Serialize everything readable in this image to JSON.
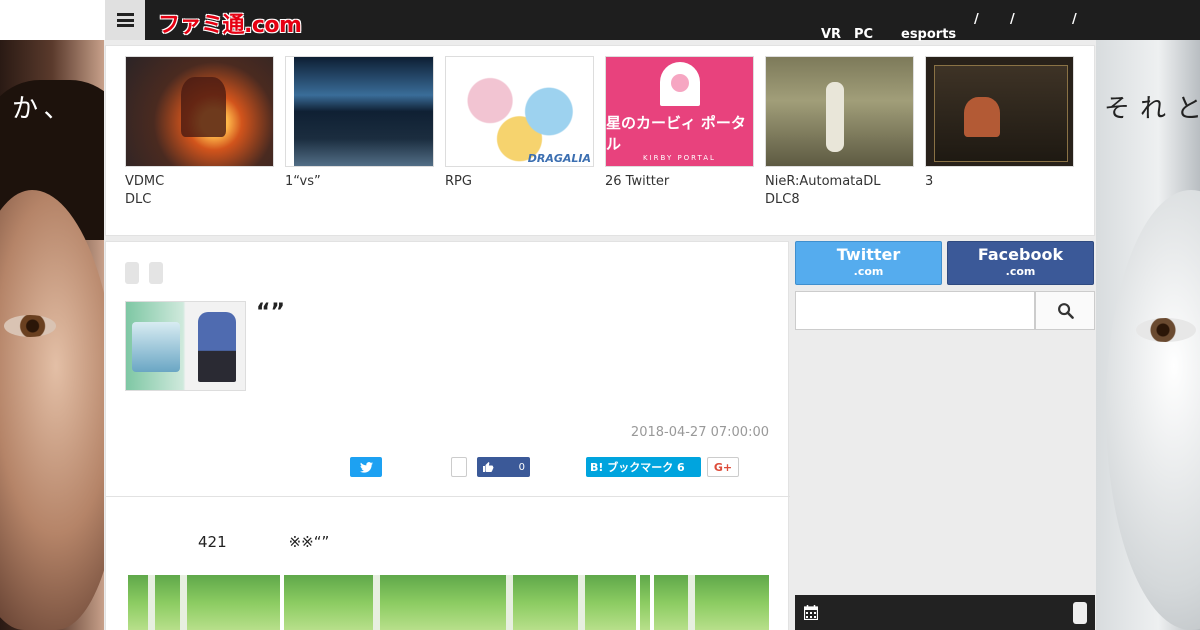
{
  "background": {
    "left_text": "か、",
    "right_text": "それと"
  },
  "header": {
    "logo": "ファミ通.com",
    "nav": [
      "VR",
      "PC",
      "esports",
      "/",
      "/",
      "/"
    ]
  },
  "carousel": {
    "items": [
      {
        "caption_line1": "VDMC",
        "caption_line2": "DLC"
      },
      {
        "caption_line1": "1“vs”",
        "caption_line2": ""
      },
      {
        "caption_line1": "RPG",
        "caption_line2": "",
        "thumb_tag": "DRAGALIA"
      },
      {
        "caption_line1": "26 Twitter",
        "caption_line2": "",
        "thumb_title": "星のカービィ ポータル",
        "thumb_sub": "KIRBY PORTAL"
      },
      {
        "caption_line1": "NieR:AutomataDL",
        "caption_line2": "DLC8"
      },
      {
        "caption_line1": "3",
        "caption_line2": ""
      }
    ]
  },
  "article": {
    "title": "“”",
    "date": "2018-04-27 07:00:00",
    "share": {
      "facebook_count": "0",
      "hatena_label": "B! ブックマーク 6",
      "google_plus_label": "G+"
    },
    "body_text": "421             ※※“”"
  },
  "sidebar": {
    "twitter_label": "Twitter",
    "twitter_sub": ".com",
    "facebook_label": "Facebook",
    "facebook_sub": ".com",
    "search_placeholder": ""
  },
  "colors": {
    "header_bg": "#1e1e1e",
    "logo_red": "#e60012",
    "twitter_blue": "#55acee",
    "facebook_blue": "#3b5998",
    "hatena_blue": "#00a4de"
  },
  "icons": [
    "menu-icon",
    "twitter-icon",
    "thumbs-up-icon",
    "search-icon",
    "calendar-icon"
  ]
}
